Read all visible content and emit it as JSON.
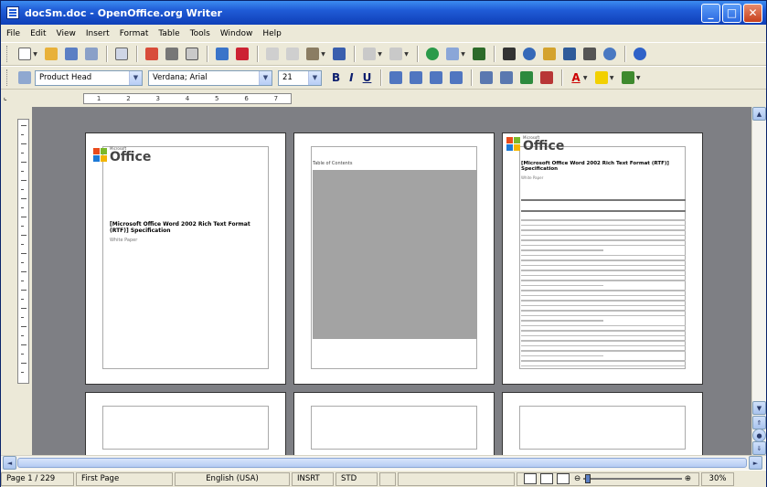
{
  "window": {
    "title": "docSm.doc - OpenOffice.org Writer"
  },
  "menu": [
    "File",
    "Edit",
    "View",
    "Insert",
    "Format",
    "Table",
    "Tools",
    "Window",
    "Help"
  ],
  "formatting": {
    "paragraph_style": "Product Head",
    "font_name": "Verdana; Arial",
    "font_size": "21",
    "bold_label": "B",
    "italic_label": "I",
    "underline_label": "U",
    "font_color_label": "A"
  },
  "ruler": {
    "marks": [
      "1",
      "2",
      "3",
      "4",
      "5",
      "6",
      "7"
    ]
  },
  "pages": {
    "p1": {
      "logo_ms": "Microsoft",
      "logo_office": "Office",
      "heading": "[Microsoft Office Word 2002 Rich Text Format (RTF)] Specification",
      "sub": "White Paper"
    },
    "p2": {
      "toc_title": "Table of Contents"
    },
    "p3": {
      "logo_ms": "Microsoft",
      "logo_office": "Office",
      "heading": "[Microsoft Office Word 2002 Rich Text Format (RTF)] Specification",
      "sub": "White Paper"
    }
  },
  "statusbar": {
    "page": "Page 1 / 229",
    "page_style": "First Page",
    "language": "English (USA)",
    "insert_mode": "INSRT",
    "selection_mode": "STD",
    "zoom": "30%"
  },
  "colors": {
    "titlebar": "#1f5bd6",
    "workspace": "#7e7f84",
    "chrome": "#ece9d8"
  }
}
